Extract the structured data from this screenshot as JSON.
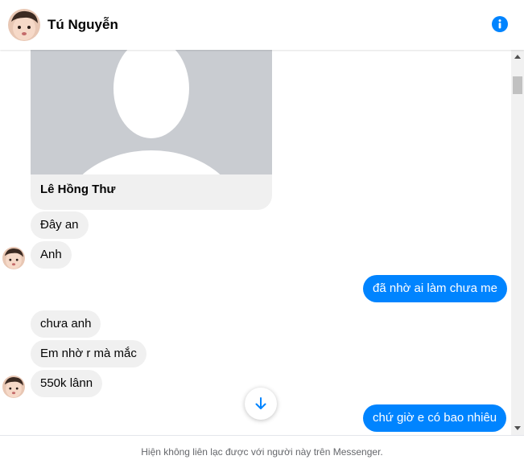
{
  "header": {
    "contact_name": "Tú Nguyễn",
    "info_icon": "info-icon"
  },
  "shared_contact": {
    "name": "Lê Hồng Thư"
  },
  "messages": [
    {
      "side": "in",
      "text": "Đây an"
    },
    {
      "side": "in",
      "text": "Anh"
    },
    {
      "side": "out",
      "text": "đã nhờ ai làm chưa me"
    },
    {
      "side": "in",
      "text": "chưa anh"
    },
    {
      "side": "in",
      "text": "Em nhờ r mà mắc"
    },
    {
      "side": "in",
      "text": "550k lânn"
    },
    {
      "side": "out",
      "text": "chứ giờ e có bao nhiêu"
    }
  ],
  "footer": {
    "notice": "Hiện không liên lạc được với người này trên Messenger."
  },
  "colors": {
    "accent": "#0084ff",
    "incoming_bubble": "#f0f0f0",
    "outgoing_text": "#ffffff"
  }
}
